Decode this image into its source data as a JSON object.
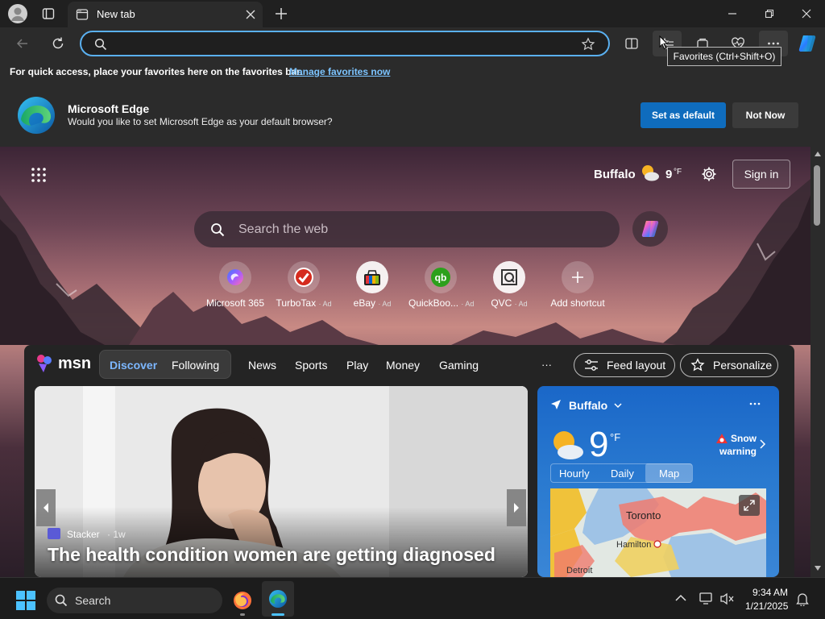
{
  "tab": {
    "title": "New tab"
  },
  "omnibox": {
    "value": ""
  },
  "tooltip": {
    "text": "Favorites (Ctrl+Shift+O)"
  },
  "favorites_bar": {
    "message": "For quick access, place your favorites here on the favorites bar.",
    "link": "Manage favorites now"
  },
  "default_banner": {
    "title": "Microsoft Edge",
    "message": "Would you like to set Microsoft Edge as your default browser?",
    "primary_button": "Set as default",
    "secondary_button": "Not Now"
  },
  "ntp": {
    "location": "Buffalo",
    "temperature": "9",
    "unit": "°F",
    "sign_in": "Sign in",
    "search_placeholder": "Search the web",
    "shortcuts": [
      {
        "label": "Microsoft 365",
        "ad": ""
      },
      {
        "label": "TurboTax",
        "ad": "· Ad"
      },
      {
        "label": "eBay",
        "ad": "· Ad"
      },
      {
        "label": "QuickBoo...",
        "ad": "· Ad"
      },
      {
        "label": "QVC",
        "ad": "· Ad"
      },
      {
        "label": "Add shortcut",
        "ad": ""
      }
    ]
  },
  "msn": {
    "brand": "msn",
    "tabs": [
      "Discover",
      "Following"
    ],
    "nav": [
      "News",
      "Sports",
      "Play",
      "Money",
      "Gaming"
    ],
    "more": "···",
    "feed_layout": "Feed layout",
    "personalize": "Personalize"
  },
  "hero": {
    "source": "Stacker",
    "age": "· 1w",
    "title": "The health condition women are getting diagnosed"
  },
  "weather_card": {
    "location": "Buffalo",
    "temperature": "9",
    "unit": "°F",
    "alert_line1": "Snow",
    "alert_line2": "warning",
    "tabs": [
      "Hourly",
      "Daily",
      "Map"
    ],
    "active_tab": "Map",
    "map_labels": [
      "Toronto",
      "Hamilton",
      "Detroit"
    ]
  },
  "taskbar": {
    "search_placeholder": "Search",
    "time": "9:34 AM",
    "date": "1/21/2025"
  },
  "colors": {
    "accent": "#0f6cbd",
    "focus_ring": "#5ab0f0",
    "weather_blue": "#1a67c8"
  }
}
